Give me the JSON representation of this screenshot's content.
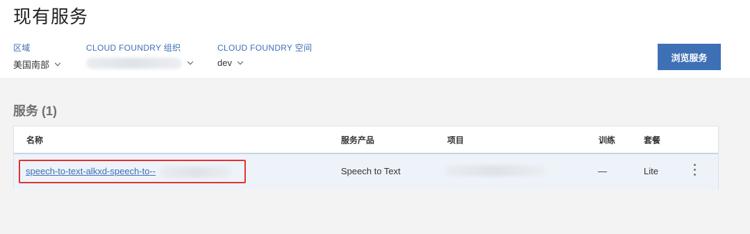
{
  "page": {
    "title": "现有服务"
  },
  "filters": {
    "region": {
      "label": "区域",
      "value": "美国南部"
    },
    "org": {
      "label": "CLOUD FOUNDRY 组织",
      "value": ""
    },
    "space": {
      "label": "CLOUD FOUNDRY 空间",
      "value": "dev"
    }
  },
  "toolbar": {
    "browse_label": "浏览服务"
  },
  "services": {
    "title": "服务 (1)",
    "columns": [
      "名称",
      "服务产品",
      "项目",
      "训练",
      "套餐"
    ],
    "rows": [
      {
        "name": "speech-to-text-alkxd-speech-to--",
        "offering": "Speech to Text",
        "project": "",
        "training": "—",
        "plan": "Lite"
      }
    ]
  },
  "colors": {
    "accent": "#3e70b5",
    "link": "#3b6fb6",
    "highlight_border": "#e0312f",
    "row_bg": "#eef3fa"
  },
  "icons": {
    "dropdown": "chevron-down-icon",
    "overflow": "overflow-menu-icon"
  }
}
